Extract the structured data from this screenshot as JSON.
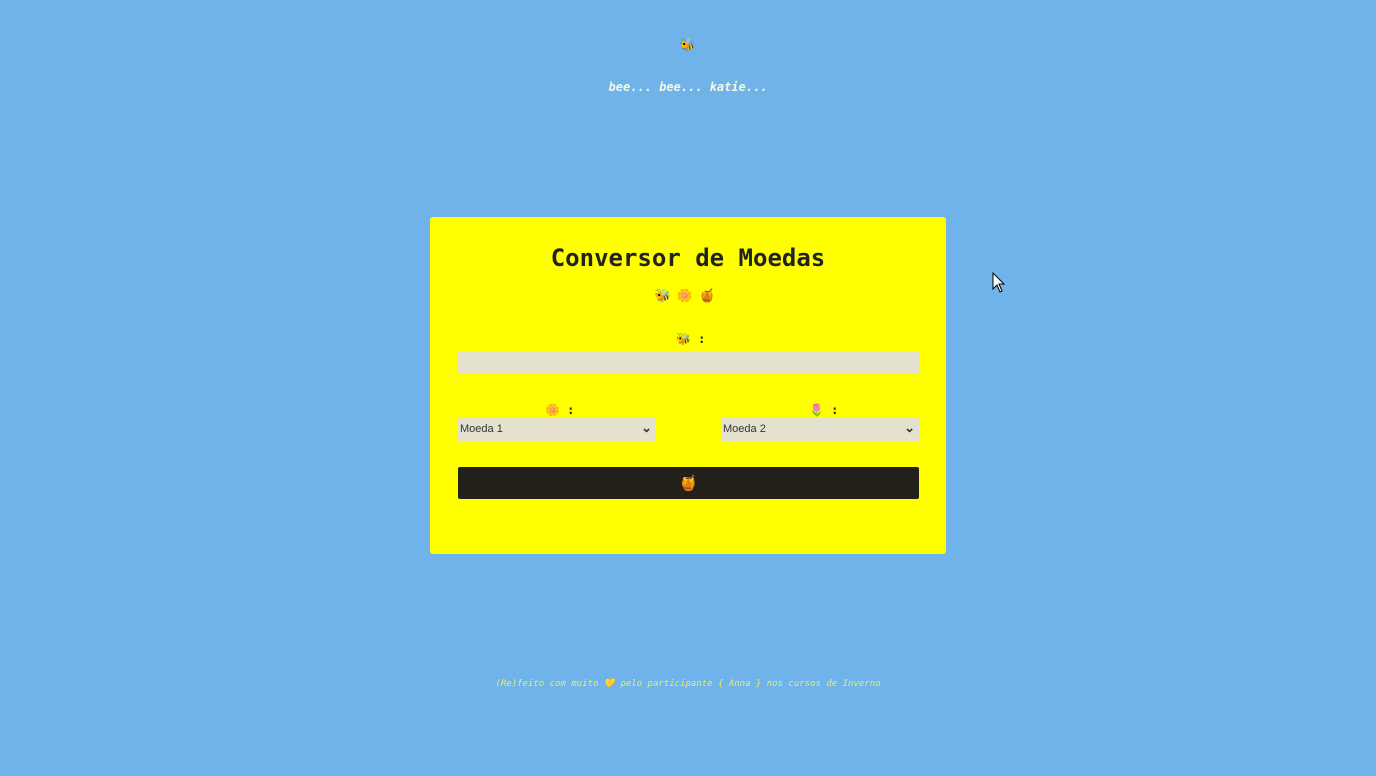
{
  "header": {
    "emoji": "🐝",
    "tagline": "bee... bee... katie..."
  },
  "card": {
    "title": "Conversor de Moedas",
    "icons": "🐝🌼🍯",
    "amount_label": "🐝 :",
    "amount_value": "",
    "from_label": "🌼 :",
    "from_value": "Moeda 1",
    "to_label": "🌷 :",
    "to_value": "Moeda 2",
    "convert_button": "🍯"
  },
  "footer": {
    "text": "(Re)feito com muito 💛 pelo participante { Anna } nos cursos de Inverno"
  }
}
